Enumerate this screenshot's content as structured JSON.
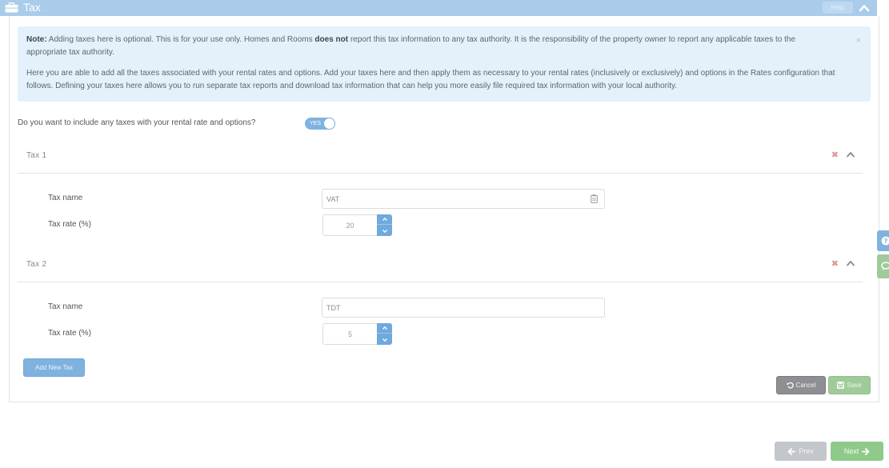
{
  "header": {
    "title": "Tax",
    "help_label": "Help",
    "icon": "briefcase-icon"
  },
  "alert": {
    "note_label": "Note:",
    "note_text_1": " Adding taxes here is optional. This is for your use only. Homes and Rooms ",
    "note_bold": "does not",
    "note_text_2": " report this tax information to any tax authority. It is the responsibility of the property owner to report any applicable taxes to the appropriate tax authority.",
    "paragraph_2": "Here you are able to add all the taxes associated with your rental rates and options. Add your taxes here and then apply them as necessary to your rental rates (inclusively or exclusively) and options in the Rates configuration that follows. Defining your taxes here allows you to run separate tax reports and download tax information that can help you more easily file required tax information with your local authority.",
    "close_label": "×"
  },
  "question": {
    "text": "Do you want to include any taxes with your rental rate and options?",
    "toggle_label": "YES",
    "toggle_on": true
  },
  "taxes": [
    {
      "title": "Tax 1",
      "name_label": "Tax name",
      "name_value": "VAT",
      "rate_label": "Tax rate (%)",
      "rate_value": "20"
    },
    {
      "title": "Tax 2",
      "name_label": "Tax name",
      "name_value": "TDT",
      "rate_label": "Tax rate (%)",
      "rate_value": "5"
    }
  ],
  "actions": {
    "add_label": "Add New Tax",
    "cancel_label": "Cancel",
    "save_label": "Save"
  },
  "nav": {
    "prev_label": "Prev",
    "next_label": "Next"
  },
  "colors": {
    "header": "#a9ccea",
    "primary": "#7fb2df",
    "success": "#9fcb9a",
    "alert_bg": "#e4f1fa"
  }
}
